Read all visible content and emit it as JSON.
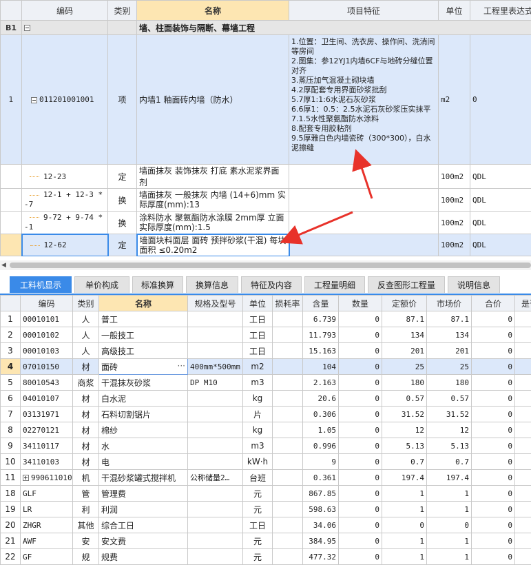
{
  "top": {
    "headers": [
      "编码",
      "类别",
      "名称",
      "项目特征",
      "单位",
      "工程里表达式"
    ],
    "group": {
      "rownum": "B1",
      "title": "墙、柱面装饰与隔断、幕墙工程"
    },
    "item": {
      "rownum": "1",
      "code": "011201001001",
      "type": "项",
      "name": "内墙1 釉面砖内墙（防水）",
      "features": [
        "1.位置：卫生间、洗衣房、操作间、洗消间等房间",
        "2.图集：参12YJ1内墙6CF与地砖分缝位置对齐",
        "3.蒸压加气混凝土砌块墙",
        "4.2厚配套专用界面砂浆批刮",
        "5.7厚1:1:6水泥石灰砂浆",
        "6.6厚1：0.5：2.5水泥石灰砂浆压实抹平",
        "7.1.5水性聚氨酯防水涂料",
        "8.配套专用胶粘剂",
        "9.5厚雅白色内墙瓷砖（300*300），白水泥擦缝"
      ],
      "unit": "m2",
      "expr": "0"
    },
    "subs": [
      {
        "code": "12-23",
        "type": "定",
        "name": "墙面抹灰 装饰抹灰 打底 素水泥浆界面剂",
        "unit": "100m2",
        "expr": "QDL"
      },
      {
        "code": "12-1 + 12-3 * -7",
        "type": "换",
        "name": "墙面抹灰 一般抹灰 内墙 (14+6)mm  实际厚度(mm):13",
        "unit": "100m2",
        "expr": "QDL"
      },
      {
        "code": "9-72 + 9-74 * -1",
        "type": "换",
        "name": "涂料防水 聚氨酯防水涂膜 2mm厚 立面  实际厚度(mm):1.5",
        "unit": "100m2",
        "expr": "QDL"
      },
      {
        "code": "12-62",
        "type": "定",
        "name": "墙面块料面层 面砖 预拌砂浆(干混) 每块面积 ≤0.20m2",
        "unit": "100m2",
        "expr": "QDL"
      }
    ]
  },
  "tabs": [
    "工料机显示",
    "单价构成",
    "标准换算",
    "换算信息",
    "特征及内容",
    "工程量明细",
    "反查图形工程量",
    "说明信息"
  ],
  "bottom": {
    "headers": [
      "编码",
      "类别",
      "名称",
      "规格及型号",
      "单位",
      "损耗率",
      "含量",
      "数量",
      "定额价",
      "市场价",
      "合价",
      "是否"
    ],
    "rows": [
      {
        "n": "1",
        "code": "00010101",
        "type": "人",
        "name": "普工",
        "spec": "",
        "unit": "工日",
        "loss": "",
        "qty": "6.739",
        "amount": "0",
        "price": "87.1",
        "market": "87.1",
        "total": "0"
      },
      {
        "n": "2",
        "code": "00010102",
        "type": "人",
        "name": "一般技工",
        "spec": "",
        "unit": "工日",
        "loss": "",
        "qty": "11.793",
        "amount": "0",
        "price": "134",
        "market": "134",
        "total": "0"
      },
      {
        "n": "3",
        "code": "00010103",
        "type": "人",
        "name": "高级技工",
        "spec": "",
        "unit": "工日",
        "loss": "",
        "qty": "15.163",
        "amount": "0",
        "price": "201",
        "market": "201",
        "total": "0"
      },
      {
        "n": "4",
        "code": "07010150",
        "type": "材",
        "name": "面砖",
        "spec": "400mm*500mm",
        "unit": "m2",
        "loss": "",
        "qty": "104",
        "amount": "0",
        "price": "25",
        "market": "25",
        "total": "0"
      },
      {
        "n": "5",
        "code": "80010543",
        "type": "商浆",
        "name": "干混抹灰砂浆",
        "spec": "DP M10",
        "unit": "m3",
        "loss": "",
        "qty": "2.163",
        "amount": "0",
        "price": "180",
        "market": "180",
        "total": "0"
      },
      {
        "n": "6",
        "code": "04010107",
        "type": "材",
        "name": "白水泥",
        "spec": "",
        "unit": "kg",
        "loss": "",
        "qty": "20.6",
        "amount": "0",
        "price": "0.57",
        "market": "0.57",
        "total": "0"
      },
      {
        "n": "7",
        "code": "03131971",
        "type": "材",
        "name": "石料切割锯片",
        "spec": "",
        "unit": "片",
        "loss": "",
        "qty": "0.306",
        "amount": "0",
        "price": "31.52",
        "market": "31.52",
        "total": "0"
      },
      {
        "n": "8",
        "code": "02270121",
        "type": "材",
        "name": "棉纱",
        "spec": "",
        "unit": "kg",
        "loss": "",
        "qty": "1.05",
        "amount": "0",
        "price": "12",
        "market": "12",
        "total": "0"
      },
      {
        "n": "9",
        "code": "34110117",
        "type": "材",
        "name": "水",
        "spec": "",
        "unit": "m3",
        "loss": "",
        "qty": "0.996",
        "amount": "0",
        "price": "5.13",
        "market": "5.13",
        "total": "0"
      },
      {
        "n": "10",
        "code": "34110103",
        "type": "材",
        "name": "电",
        "spec": "",
        "unit": "kW·h",
        "loss": "",
        "qty": "9",
        "amount": "0",
        "price": "0.7",
        "market": "0.7",
        "total": "0"
      },
      {
        "n": "11",
        "code": "990611010",
        "type": "机",
        "name": "干混砂浆罐式搅拌机",
        "spec": "公称储量2…",
        "unit": "台班",
        "loss": "",
        "qty": "0.361",
        "amount": "0",
        "price": "197.4",
        "market": "197.4",
        "total": "0"
      },
      {
        "n": "18",
        "code": "GLF",
        "type": "管",
        "name": "管理费",
        "spec": "",
        "unit": "元",
        "loss": "",
        "qty": "867.85",
        "amount": "0",
        "price": "1",
        "market": "1",
        "total": "0"
      },
      {
        "n": "19",
        "code": "LR",
        "type": "利",
        "name": "利润",
        "spec": "",
        "unit": "元",
        "loss": "",
        "qty": "598.63",
        "amount": "0",
        "price": "1",
        "market": "1",
        "total": "0"
      },
      {
        "n": "20",
        "code": "ZHGR",
        "type": "其他",
        "name": "综合工日",
        "spec": "",
        "unit": "工日",
        "loss": "",
        "qty": "34.06",
        "amount": "0",
        "price": "0",
        "market": "0",
        "total": "0"
      },
      {
        "n": "21",
        "code": "AWF",
        "type": "安",
        "name": "安文费",
        "spec": "",
        "unit": "元",
        "loss": "",
        "qty": "384.95",
        "amount": "0",
        "price": "1",
        "market": "1",
        "total": "0"
      },
      {
        "n": "22",
        "code": "GF",
        "type": "规",
        "name": "规费",
        "spec": "",
        "unit": "元",
        "loss": "",
        "qty": "477.32",
        "amount": "0",
        "price": "1",
        "market": "1",
        "total": "0"
      }
    ]
  },
  "colors": {
    "accent": "#3a8ae8",
    "highlight": "#fde6b2",
    "selected": "#dce8fa",
    "annotation": "#e8322a"
  }
}
